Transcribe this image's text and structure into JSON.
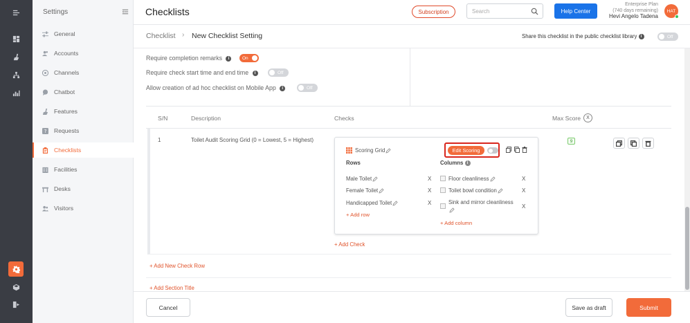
{
  "rail": {
    "items": [
      {
        "icon": "collapse-menu-icon"
      },
      {
        "icon": "dashboard-icon"
      },
      {
        "icon": "broom-icon"
      },
      {
        "icon": "org-chart-icon"
      },
      {
        "icon": "analytics-icon"
      },
      {
        "icon": "settings-gear-icon",
        "active": true
      },
      {
        "icon": "cube-icon"
      },
      {
        "icon": "logout-icon"
      }
    ]
  },
  "sidebar": {
    "title": "Settings",
    "items": [
      {
        "label": "General",
        "icon": "sliders-icon"
      },
      {
        "label": "Accounts",
        "icon": "users-icon"
      },
      {
        "label": "Channels",
        "icon": "channels-icon"
      },
      {
        "label": "Chatbot",
        "icon": "chat-icon"
      },
      {
        "label": "Features",
        "icon": "broom-icon"
      },
      {
        "label": "Requests",
        "icon": "help-icon"
      },
      {
        "label": "Checklists",
        "icon": "clipboard-icon",
        "active": true
      },
      {
        "label": "Facilities",
        "icon": "building-icon"
      },
      {
        "label": "Desks",
        "icon": "desk-icon"
      },
      {
        "label": "Visitors",
        "icon": "visitors-icon"
      }
    ]
  },
  "header": {
    "title": "Checklists",
    "subscription_label": "Subscription",
    "search_placeholder": "Search",
    "help_label": "Help Center",
    "plan_name": "Enterprise Plan",
    "plan_days": "(740 days remaining)",
    "user_name": "Hevi Angelo Tadena",
    "avatar_initials": "HAT"
  },
  "breadcrumb": {
    "root": "Checklist",
    "current": "New Checklist Setting",
    "share_text": "Share this checklist in the public checklist library",
    "share_toggle": "Off"
  },
  "options": [
    {
      "label": "Require completion remarks",
      "toggle": "On"
    },
    {
      "label": "Require check start time and end time",
      "toggle": "Off"
    },
    {
      "label": "Allow creation of ad hoc checklist on Mobile App",
      "toggle": "Off"
    }
  ],
  "table": {
    "headers": {
      "sn": "S/N",
      "description": "Description",
      "checks": "Checks",
      "max_score": "Max Score"
    },
    "close_glyph": "X",
    "row": {
      "sn": "1",
      "description": "Toilet Audit Scoring Grid (0 = Lowest, 5 = Highest)",
      "score": "9",
      "grid": {
        "title": "Scoring Grid",
        "edit_scoring_label": "Edit Scoring",
        "rows_label": "Rows",
        "columns_label": "Columns",
        "rows": [
          "Male Toilet",
          "Female Toilet",
          "Handicapped Toilet"
        ],
        "columns": [
          "Floor cleanliness",
          "Toilet bowl condition",
          "Sink and mirror cleanliness"
        ],
        "add_row": "+ Add row",
        "add_column": "+ Add column"
      },
      "add_check": "+ Add Check"
    }
  },
  "links": {
    "add_check_row": "+ Add New Check Row",
    "add_section_title": "+ Add Section Title"
  },
  "footer": {
    "cancel": "Cancel",
    "save_draft": "Save as draft",
    "submit": "Submit"
  },
  "colors": {
    "accent": "#f26b3a",
    "primary": "#1a73e8",
    "highlight": "#d9251c"
  }
}
